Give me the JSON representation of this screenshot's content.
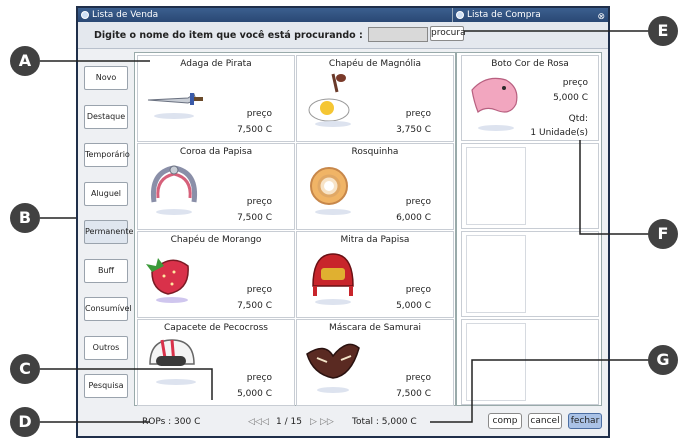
{
  "window": {
    "left_title": "Lista de Venda",
    "right_title": "Lista de Compra",
    "close_glyph": "⊗"
  },
  "search": {
    "prompt": "Digite o nome do item que você está procurando :",
    "value": "",
    "button": "procura"
  },
  "sidebar": {
    "items": [
      {
        "label": "Novo"
      },
      {
        "label": "Destaque"
      },
      {
        "label": "Temporário"
      },
      {
        "label": "Aluguel"
      },
      {
        "label": "Permanente"
      },
      {
        "label": "Buff"
      },
      {
        "label": "Consumível"
      },
      {
        "label": "Outros"
      },
      {
        "label": "Pesquisa"
      }
    ],
    "selected": "Permanente"
  },
  "items": [
    {
      "name": "Adaga de Pirata",
      "price_label": "preço",
      "price": "7,500 C",
      "icon": "dagger-icon"
    },
    {
      "name": "Chapéu de Magnólia",
      "price_label": "preço",
      "price": "3,750 C",
      "icon": "egg-hat-icon"
    },
    {
      "name": "Coroa da Papisa",
      "price_label": "preço",
      "price": "7,500 C",
      "icon": "crown-icon"
    },
    {
      "name": "Rosquinha",
      "price_label": "preço",
      "price": "6,000 C",
      "icon": "donut-icon"
    },
    {
      "name": "Chapéu de Morango",
      "price_label": "preço",
      "price": "7,500 C",
      "icon": "strawberry-hat-icon"
    },
    {
      "name": "Mitra da Papisa",
      "price_label": "preço",
      "price": "5,000 C",
      "icon": "mitre-icon"
    },
    {
      "name": "Capacete de Pecocross",
      "price_label": "preço",
      "price": "5,000 C",
      "icon": "helmet-icon"
    },
    {
      "name": "Máscara de Samurai",
      "price_label": "preço",
      "price": "7,500 C",
      "icon": "mask-icon"
    }
  ],
  "cart": {
    "item_name": "Boto Cor de Rosa",
    "price_label": "preço",
    "price": "5,000 C",
    "qty_label": "Qtd:",
    "qty": "1 Unidade(s)",
    "icon": "pink-dolphin-icon"
  },
  "status": {
    "rops": "ROPs : 300 C",
    "page": "1 / 15",
    "nav_first": "◁◁",
    "nav_prev": "◁",
    "nav_next": "▷",
    "nav_last": "▷▷",
    "total": "Total : 5,000 C"
  },
  "buttons": {
    "comp": "comp",
    "cancel": "cancel",
    "close": "fechar"
  },
  "callouts": [
    "A",
    "B",
    "C",
    "D",
    "E",
    "F",
    "G"
  ],
  "colors": {
    "titlebar": "#2f507e",
    "primary_button": "#aac2e6",
    "callout": "#414141"
  }
}
